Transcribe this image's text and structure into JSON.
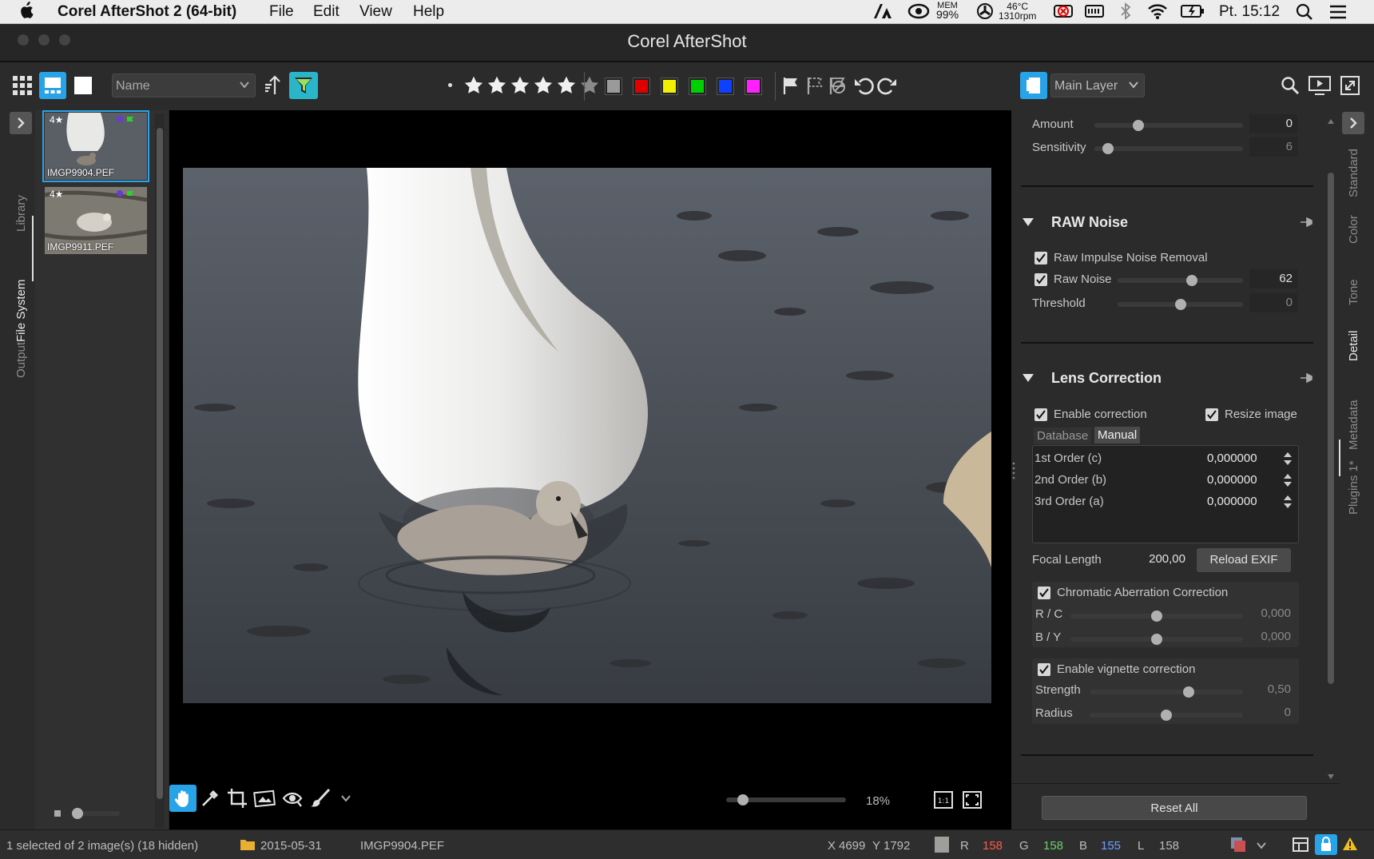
{
  "menubar": {
    "app_name": "Corel AfterShot 2 (64-bit)",
    "items": [
      "File",
      "Edit",
      "View",
      "Help"
    ],
    "mem_label": "MEM",
    "mem_value": "99%",
    "temp": "46°C",
    "rpm": "1310rpm",
    "clock": "Pt. 15:12"
  },
  "window": {
    "title": "Corel AfterShot"
  },
  "toolbar": {
    "sort_value": "Name",
    "rating_stars": 5,
    "color_labels": [
      "#9a9a9a",
      "#e00000",
      "#f0f000",
      "#00d000",
      "#1040ff",
      "#ff20ff"
    ],
    "layer_value": "Main Layer"
  },
  "left_tabs": [
    "Library",
    "File System",
    "Output"
  ],
  "active_left_tab": "File System",
  "thumbnails": [
    {
      "name": "IMGP9904.PEF",
      "rating": "4★",
      "selected": true
    },
    {
      "name": "IMGP9911.PEF",
      "rating": "4★",
      "selected": false
    }
  ],
  "zoom": {
    "value": "18%",
    "fraction": 0.1
  },
  "panel": {
    "sharpen": {
      "amount_label": "Amount",
      "amount_value": "0",
      "amount_fraction": 0.28,
      "sensitivity_label": "Sensitivity",
      "sensitivity_value": "6",
      "sensitivity_fraction": 0.06
    },
    "raw_noise": {
      "title": "RAW Noise",
      "impulse_label": "Raw Impulse Noise Removal",
      "noise_label": "Raw Noise",
      "noise_value": "62",
      "noise_fraction": 0.6,
      "threshold_label": "Threshold",
      "threshold_value": "0",
      "threshold_fraction": 0.5
    },
    "lens": {
      "title": "Lens Correction",
      "enable_label": "Enable correction",
      "resize_label": "Resize image",
      "tab_database": "Database",
      "tab_manual": "Manual",
      "orders": [
        {
          "label": "1st Order (c)",
          "value": "0,000000"
        },
        {
          "label": "2nd Order (b)",
          "value": "0,000000"
        },
        {
          "label": "3rd Order (a)",
          "value": "0,000000"
        }
      ],
      "focal_label": "Focal Length",
      "focal_value": "200,00",
      "reload_label": "Reload EXIF",
      "ca_label": "Chromatic Aberration Correction",
      "rc_label": "R / C",
      "rc_value": "0,000",
      "rc_fraction": 0.5,
      "by_label": "B / Y",
      "by_value": "0,000",
      "by_fraction": 0.5,
      "vignette_label": "Enable vignette correction",
      "strength_label": "Strength",
      "strength_value": "0,50",
      "strength_fraction": 0.66,
      "radius_label": "Radius",
      "radius_value": "0",
      "radius_fraction": 0.5
    },
    "reset_label": "Reset All"
  },
  "right_tabs": [
    "Standard",
    "Color",
    "Tone",
    "Detail",
    "Metadata",
    "Plugins 1*"
  ],
  "active_right_tab": "Detail",
  "status": {
    "selection": "1 selected of 2 image(s) (18 hidden)",
    "folder": "2015-05-31",
    "file": "IMGP9904.PEF",
    "x_label": "X",
    "x_value": "4699",
    "y_label": "Y",
    "y_value": "1792",
    "r_label": "R",
    "r_value": "158",
    "g_label": "G",
    "g_value": "158",
    "b_label": "B",
    "b_value": "155",
    "l_label": "L",
    "l_value": "158"
  },
  "colors": {
    "accent": "#29a3e8",
    "filter": "#2bb5c9"
  }
}
